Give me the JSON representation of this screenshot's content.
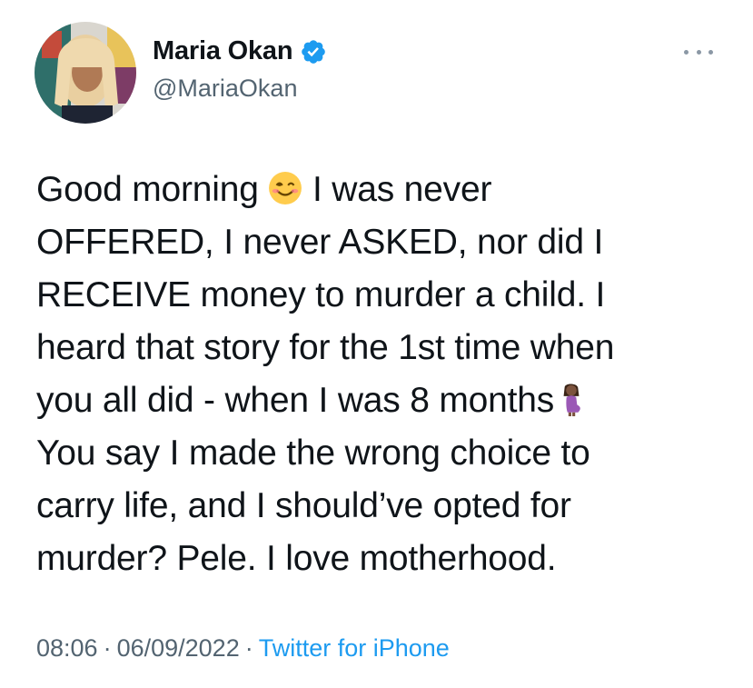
{
  "author": {
    "display_name": "Maria Okan",
    "handle": "@MariaOkan",
    "verified": true
  },
  "tweet": {
    "lines": [
      {
        "before": "Good morning ",
        "emoji": "smiling-face-icon",
        "after": " I was never"
      },
      {
        "text": "OFFERED, I never ASKED, nor did I"
      },
      {
        "text": "RECEIVE money to murder a child. I"
      },
      {
        "text": "heard that story for the 1st time when"
      },
      {
        "before": "you all did - when I was 8 months",
        "emoji": "pregnant-woman-icon",
        "after": ""
      },
      {
        "text": "You say I made the wrong choice to"
      },
      {
        "text": "carry life, and I should’ve opted for"
      },
      {
        "text": "murder? Pele. I love motherhood."
      }
    ]
  },
  "meta": {
    "time": "08:06",
    "date": "06/09/2022",
    "separator": "·",
    "source": "Twitter for iPhone"
  },
  "colors": {
    "verified_badge": "#1d9bf0",
    "link": "#1d9bf0",
    "secondary_text": "#536471"
  }
}
